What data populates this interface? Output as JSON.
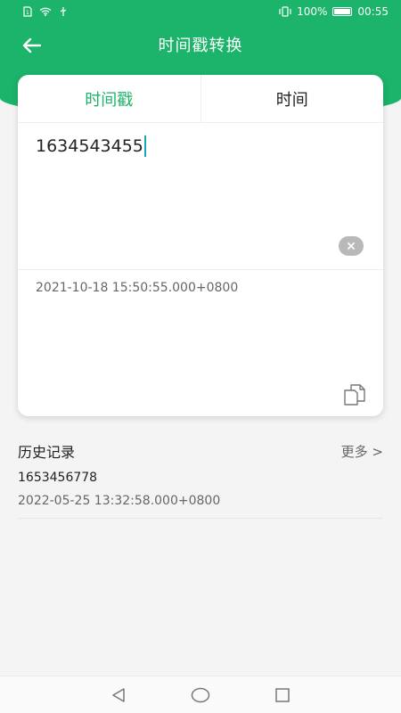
{
  "status_bar": {
    "battery_text": "100%",
    "time": "00:55"
  },
  "app_bar": {
    "title": "时间戳转换",
    "back_icon": "arrow-left-icon"
  },
  "tabs": [
    {
      "label": "时间戳",
      "active": true
    },
    {
      "label": "时间",
      "active": false
    }
  ],
  "input": {
    "value": "1634543455"
  },
  "result": {
    "text": "2021-10-18 15:50:55.000+0800"
  },
  "history": {
    "title": "历史记录",
    "more_label": "更多 >",
    "items": [
      {
        "timestamp": "1653456778",
        "datetime": "2022-05-25 13:32:58.000+0800"
      }
    ]
  },
  "colors": {
    "accent": "#1cb36a",
    "caret": "#1aa6b7"
  }
}
